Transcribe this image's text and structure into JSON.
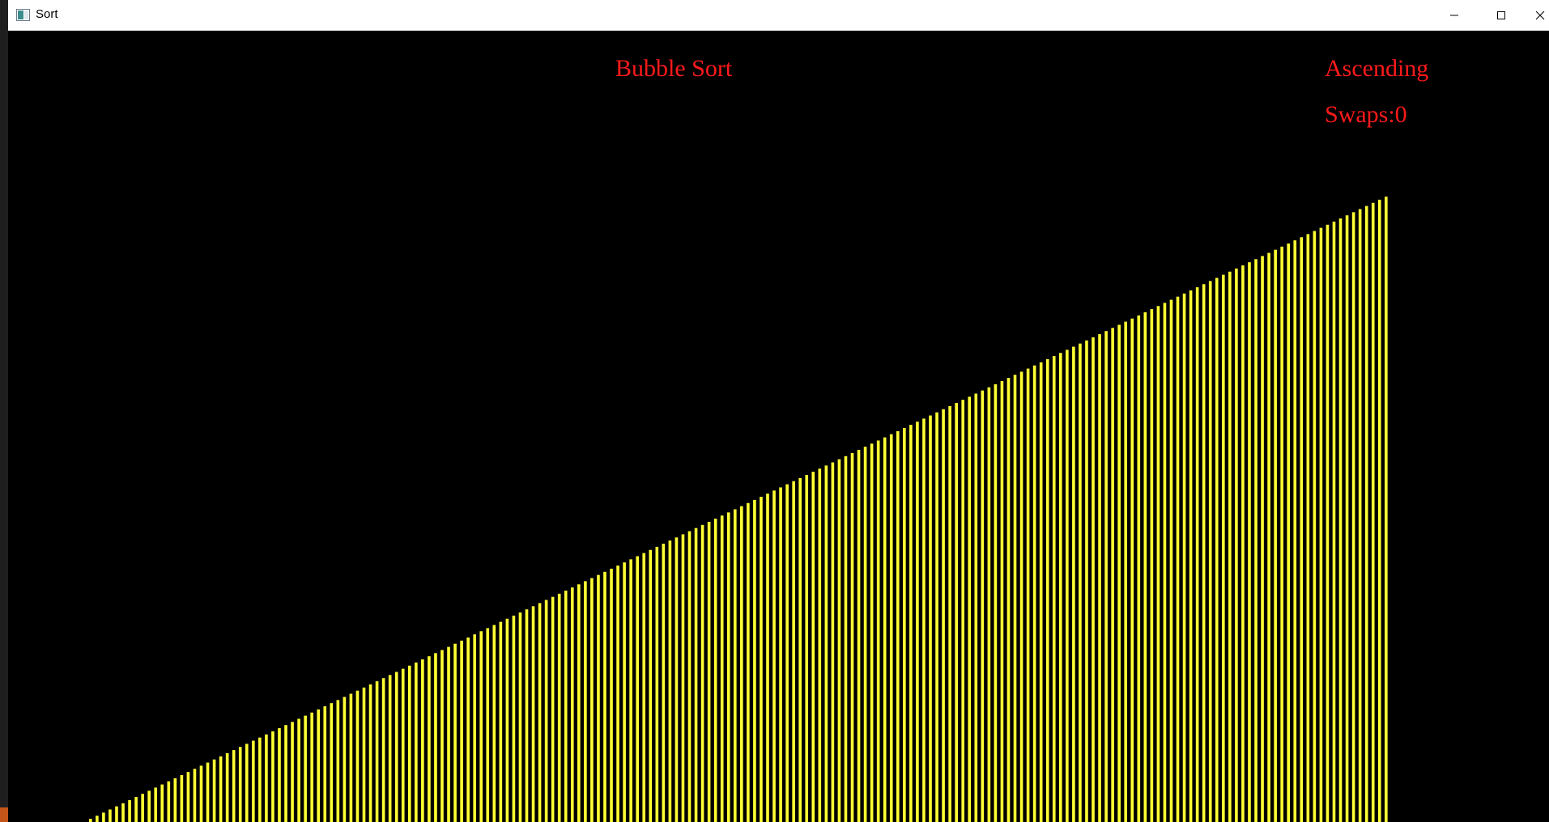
{
  "window": {
    "title": "Sort"
  },
  "visualizer": {
    "algorithm": "Bubble Sort",
    "order": "Ascending",
    "swaps_text": "Swaps:0",
    "bar_color": "#ffff33",
    "text_color": "#ff1a1a",
    "background_color": "#000000"
  },
  "chart_data": {
    "type": "bar",
    "title": "",
    "xlabel": "",
    "ylabel": "",
    "bar_count": 200,
    "series": [
      {
        "values_rule": "linearly increasing 1..200 (already sorted ascending)"
      }
    ],
    "ylim": [
      0,
      200
    ]
  },
  "icons": {
    "app": "window-app-icon",
    "minimize": "minimize-icon",
    "maximize": "maximize-icon",
    "close": "close-icon"
  }
}
